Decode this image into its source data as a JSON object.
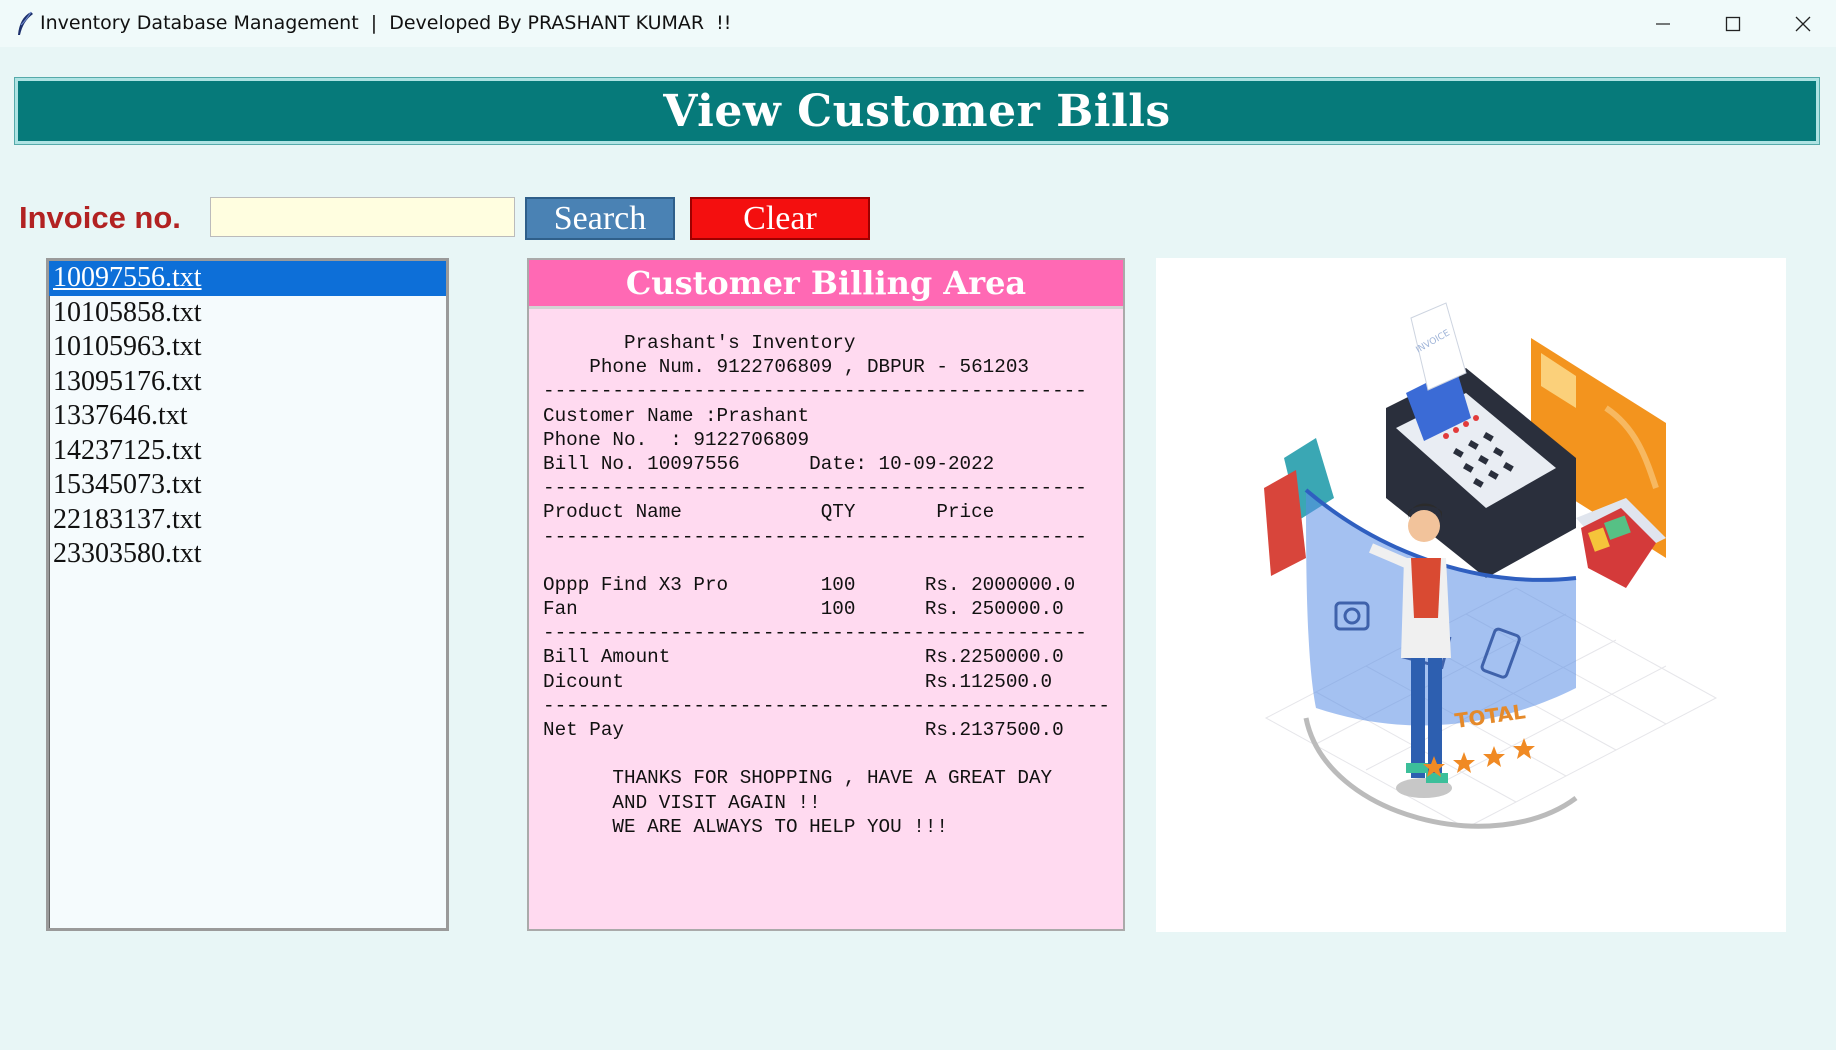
{
  "window": {
    "title": "Inventory Database Management  |  Developed By PRASHANT KUMAR  !!",
    "icon": "feather-icon"
  },
  "header": {
    "title": "View Customer Bills"
  },
  "search": {
    "label": "Invoice no.",
    "value": "",
    "search_label": "Search",
    "clear_label": "Clear"
  },
  "files": [
    "10097556.txt",
    "10105858.txt",
    "10105963.txt",
    "13095176.txt",
    "1337646.txt",
    "14237125.txt",
    "15345073.txt",
    "22183137.txt",
    "23303580.txt"
  ],
  "selected_file": "10097556.txt",
  "billing": {
    "title": "Customer Billing Area",
    "lines": [
      "       Prashant's Inventory",
      "    Phone Num. 9122706809 , DBPUR - 561203",
      "-----------------------------------------------",
      "Customer Name :Prashant",
      "Phone No.  : 9122706809",
      "Bill No. 10097556      Date: 10-09-2022",
      "-----------------------------------------------",
      "Product Name            QTY       Price",
      "-----------------------------------------------",
      "",
      "Oppp Find X3 Pro        100      Rs. 2000000.0",
      "Fan                     100      Rs. 250000.0",
      "-----------------------------------------------",
      "Bill Amount                      Rs.2250000.0",
      "Dicount                          Rs.112500.0",
      "-------------------------------------------------",
      "Net Pay                          Rs.2137500.0",
      "",
      "      THANKS FOR SHOPPING , HAVE A GREAT DAY",
      "      AND VISIT AGAIN !!",
      "      WE ARE ALWAYS TO HELP YOU !!!"
    ]
  },
  "illustration": {
    "text": "TOTAL",
    "image_text": "INVOICE"
  }
}
